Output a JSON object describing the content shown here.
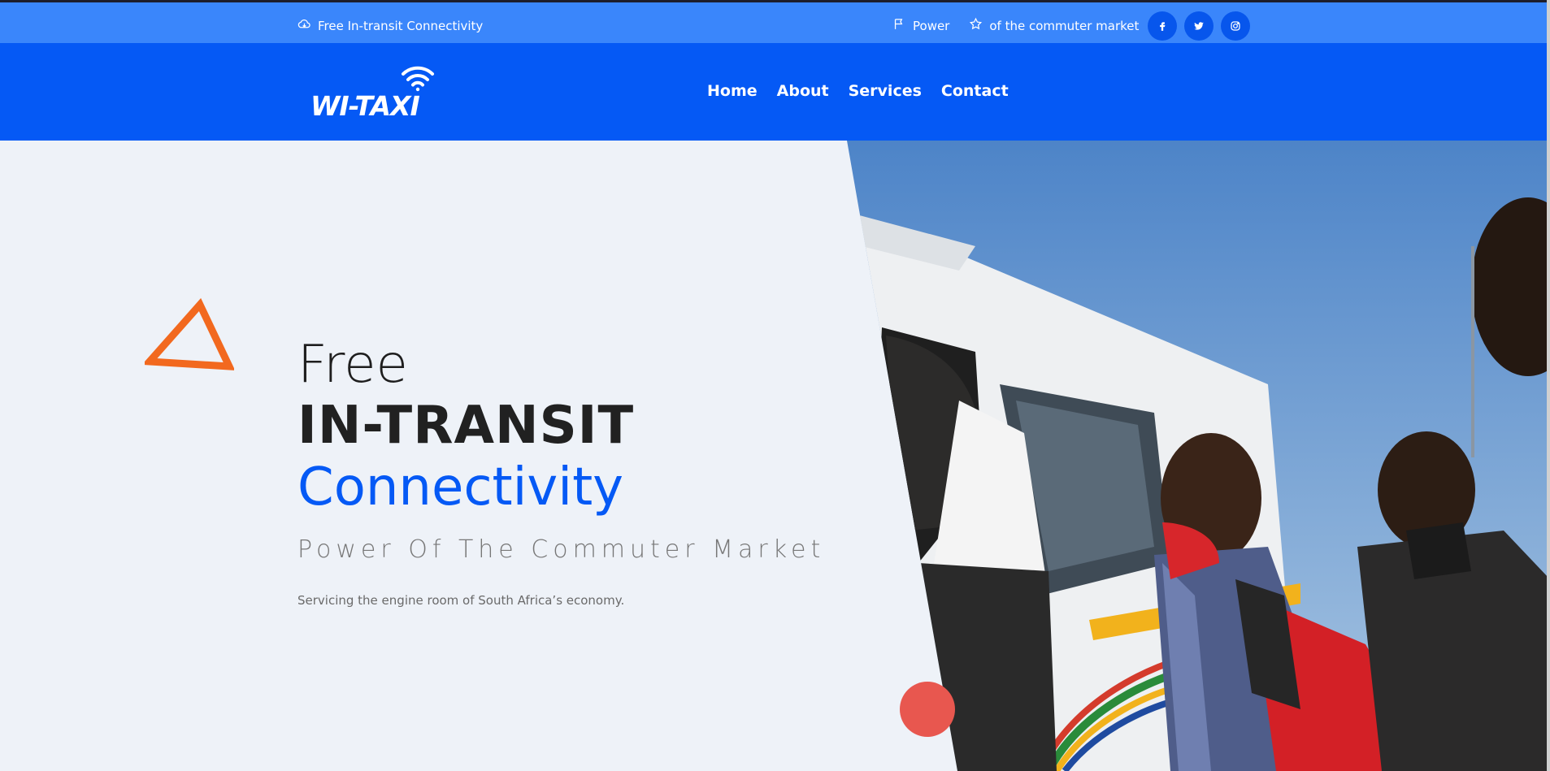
{
  "topbar": {
    "left_text": "Free In-transit Connectivity",
    "item1": "Power",
    "item2": "of the commuter market",
    "socials": [
      "facebook-icon",
      "twitter-icon",
      "instagram-icon"
    ]
  },
  "nav": {
    "logo_text": "WI-TAXI",
    "links": [
      "Home",
      "About",
      "Services",
      "Contact"
    ]
  },
  "hero": {
    "line1": "Free",
    "line2": "IN-TRANSIT",
    "line3": "Connectivity",
    "tagline": "Power Of The Commuter Market",
    "description": "Servicing the engine room of South Africa’s economy."
  },
  "colors": {
    "topbar": "#3a86fb",
    "navbar": "#0559f5",
    "accent": "#0559f5",
    "triangle": "#f2691f",
    "dot": "#e8574f"
  }
}
